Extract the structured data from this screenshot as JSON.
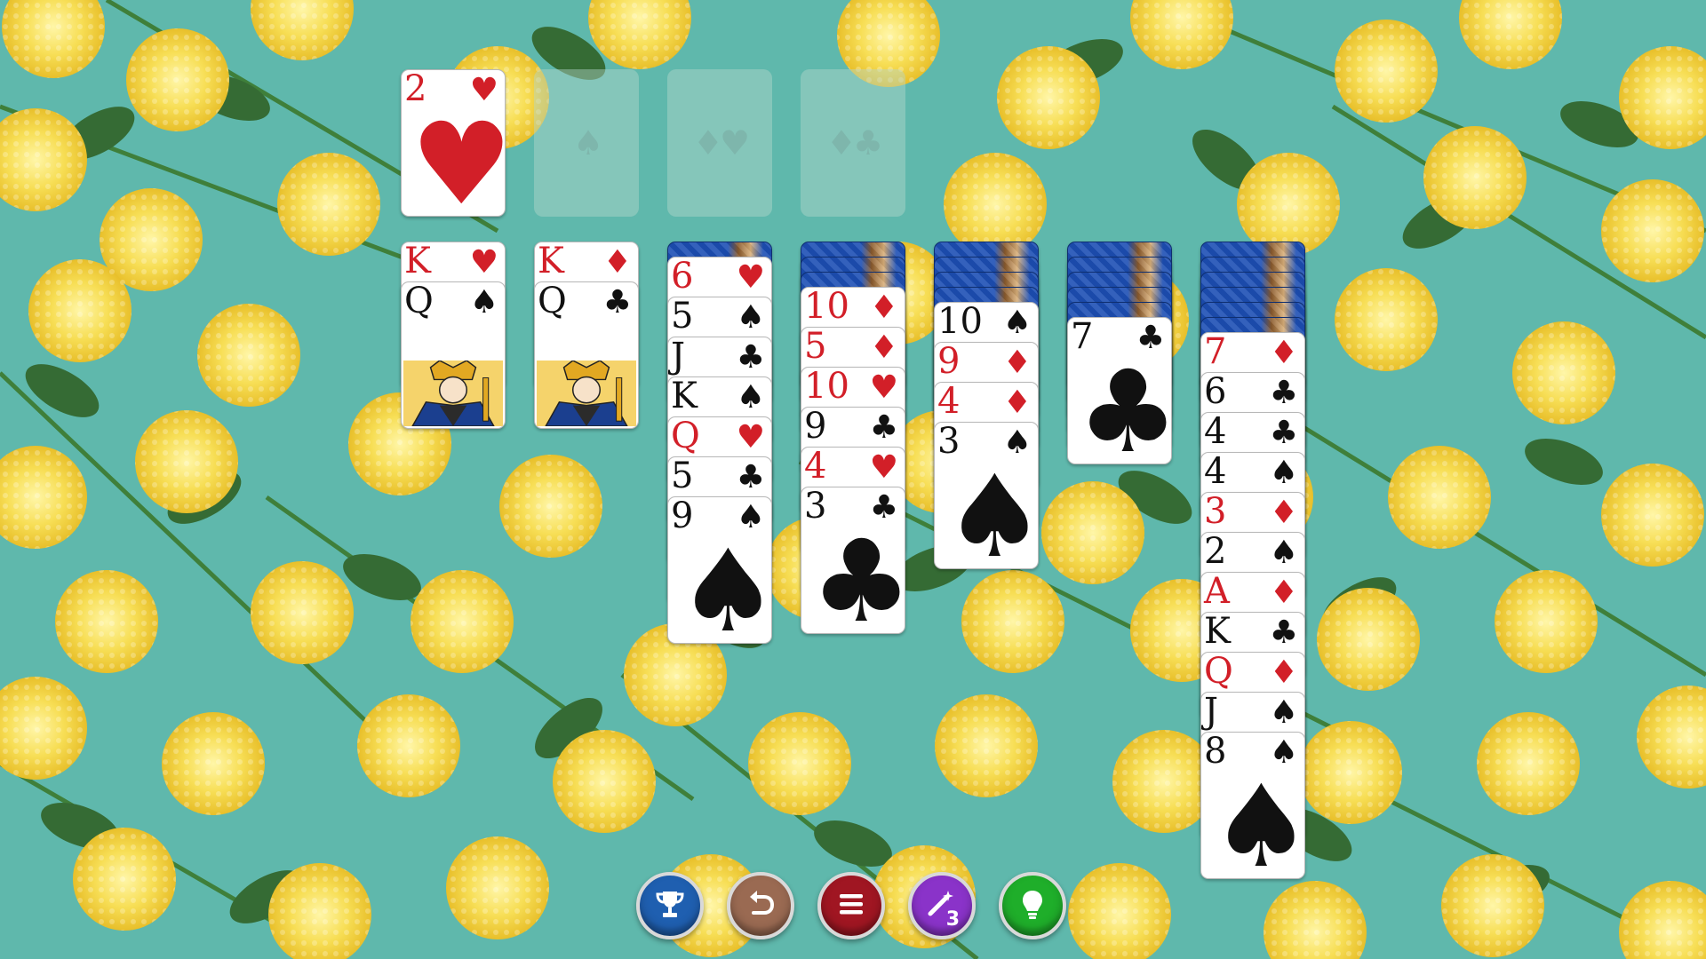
{
  "colors": {
    "felt": "#5fb8ac",
    "red_suit": "#d21f28",
    "black_suit": "#111111",
    "card_back": "#1d4fb4"
  },
  "foundations": [
    {
      "top": {
        "rank": "2",
        "suit": "♥",
        "color": "red"
      }
    },
    {
      "top": null
    },
    {
      "top": null
    },
    {
      "top": null
    }
  ],
  "tableau": [
    {
      "face_down": 0,
      "face_up": [
        {
          "rank": "K",
          "suit": "♥",
          "color": "red"
        },
        {
          "rank": "Q",
          "suit": "♠",
          "color": "black"
        }
      ]
    },
    {
      "face_down": 0,
      "face_up": [
        {
          "rank": "K",
          "suit": "♦",
          "color": "red"
        },
        {
          "rank": "Q",
          "suit": "♣",
          "color": "black"
        }
      ]
    },
    {
      "face_down": 1,
      "face_up": [
        {
          "rank": "6",
          "suit": "♥",
          "color": "red"
        },
        {
          "rank": "5",
          "suit": "♠",
          "color": "black"
        },
        {
          "rank": "J",
          "suit": "♣",
          "color": "black"
        },
        {
          "rank": "K",
          "suit": "♠",
          "color": "black"
        },
        {
          "rank": "Q",
          "suit": "♥",
          "color": "red"
        },
        {
          "rank": "5",
          "suit": "♣",
          "color": "black"
        },
        {
          "rank": "9",
          "suit": "♠",
          "color": "black"
        }
      ]
    },
    {
      "face_down": 3,
      "face_up": [
        {
          "rank": "10",
          "suit": "♦",
          "color": "red"
        },
        {
          "rank": "5",
          "suit": "♦",
          "color": "red"
        },
        {
          "rank": "10",
          "suit": "♥",
          "color": "red"
        },
        {
          "rank": "9",
          "suit": "♣",
          "color": "black"
        },
        {
          "rank": "4",
          "suit": "♥",
          "color": "red"
        },
        {
          "rank": "3",
          "suit": "♣",
          "color": "black"
        }
      ]
    },
    {
      "face_down": 4,
      "face_up": [
        {
          "rank": "10",
          "suit": "♠",
          "color": "black"
        },
        {
          "rank": "9",
          "suit": "♦",
          "color": "red"
        },
        {
          "rank": "4",
          "suit": "♦",
          "color": "red"
        },
        {
          "rank": "3",
          "suit": "♠",
          "color": "black"
        }
      ]
    },
    {
      "face_down": 5,
      "face_up": [
        {
          "rank": "7",
          "suit": "♣",
          "color": "black"
        }
      ]
    },
    {
      "face_down": 6,
      "face_up": [
        {
          "rank": "7",
          "suit": "♦",
          "color": "red"
        },
        {
          "rank": "6",
          "suit": "♣",
          "color": "black"
        },
        {
          "rank": "4",
          "suit": "♣",
          "color": "black"
        },
        {
          "rank": "4",
          "suit": "♠",
          "color": "black"
        },
        {
          "rank": "3",
          "suit": "♦",
          "color": "red"
        },
        {
          "rank": "2",
          "suit": "♠",
          "color": "black"
        },
        {
          "rank": "A",
          "suit": "♦",
          "color": "red"
        },
        {
          "rank": "K",
          "suit": "♣",
          "color": "black"
        },
        {
          "rank": "Q",
          "suit": "♦",
          "color": "red"
        },
        {
          "rank": "J",
          "suit": "♠",
          "color": "black"
        },
        {
          "rank": "8",
          "suit": "♠",
          "color": "black"
        }
      ]
    }
  ],
  "toolbar": [
    {
      "name": "trophy-button",
      "icon": "trophy-icon",
      "color": "#1f5fb0"
    },
    {
      "name": "undo-button",
      "icon": "undo-icon",
      "color": "#9a6a52"
    },
    {
      "name": "menu-button",
      "icon": "menu-icon",
      "color": "#a01622"
    },
    {
      "name": "magic-wand-button",
      "icon": "magic-wand-icon",
      "color": "#8a33c9",
      "badge": "3"
    },
    {
      "name": "hint-button",
      "icon": "lightbulb-icon",
      "color": "#1fae2a"
    }
  ]
}
